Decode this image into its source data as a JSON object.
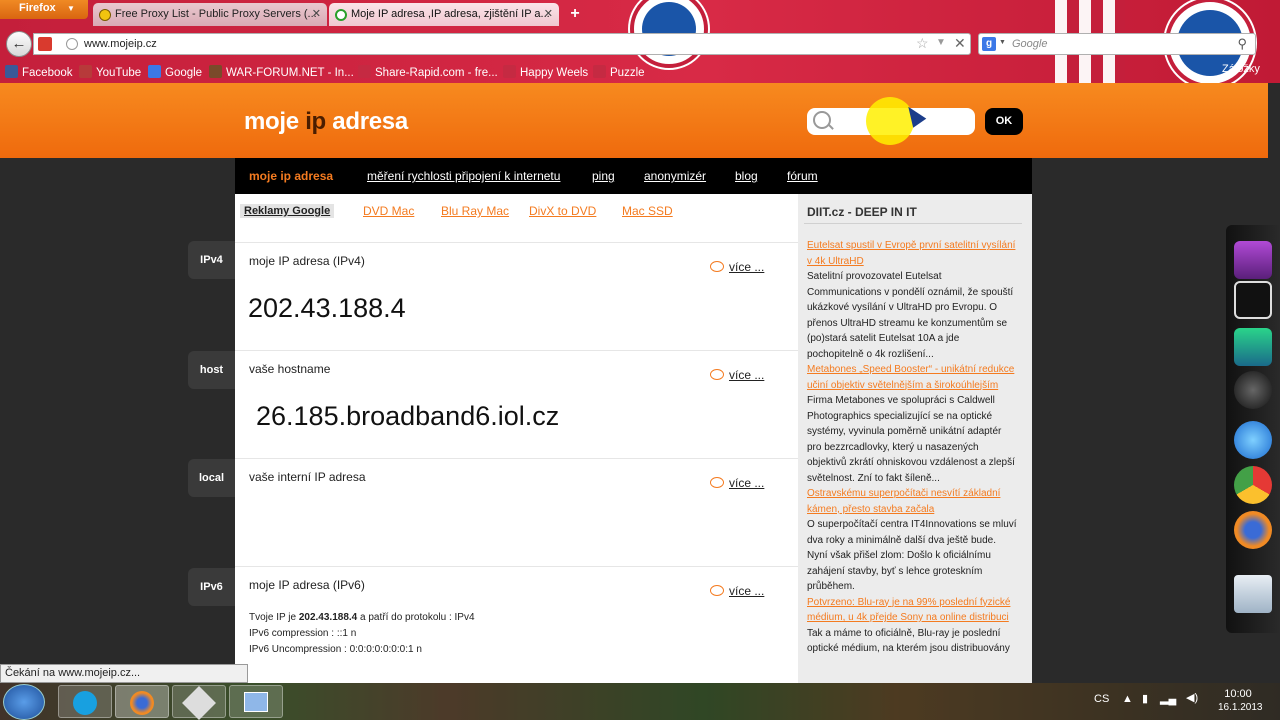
{
  "browser": {
    "app_button": "Firefox",
    "tabs": [
      {
        "label": "Free Proxy List - Public Proxy Servers (..."
      },
      {
        "label": "Moje IP adresa ,IP adresa, zjištění IP a..."
      }
    ],
    "url": "www.mojeip.cz",
    "search_placeholder": "Google",
    "bookmarks": [
      {
        "label": "Facebook",
        "icon": "facebook-icon"
      },
      {
        "label": "YouTube",
        "icon": "youtube-icon"
      },
      {
        "label": "Google",
        "icon": "google-icon"
      },
      {
        "label": "WAR-FORUM.NET - In...",
        "icon": "warforum-icon"
      },
      {
        "label": "Share-Rapid.com - fre...",
        "icon": "sharerapid-icon"
      },
      {
        "label": "Happy Weels",
        "icon": "page-icon"
      },
      {
        "label": "Puzzle",
        "icon": "page-icon"
      }
    ],
    "bookmarks_more": "Záložky",
    "status": "Čekání na www.mojeip.cz..."
  },
  "site": {
    "brand_main": "moje ",
    "brand_ip": "ip",
    "brand_rest": " adresa",
    "search_button": "OK",
    "menu": [
      "moje ip adresa",
      "měření rychlosti připojení k internetu",
      "ping",
      "anonymizér",
      "blog",
      "fórum"
    ],
    "ads_label": "Reklamy Google",
    "ads": [
      "DVD Mac",
      "Blu Ray Mac",
      "DivX to DVD",
      "Mac SSD"
    ],
    "more_label": "více ...",
    "sections": [
      {
        "tab": "IPv4",
        "title": "moje IP adresa (IPv4)",
        "value": "202.43.188.4"
      },
      {
        "tab": "host",
        "title": "vaše hostname",
        "value": "26.185.broadband6.iol.cz"
      },
      {
        "tab": "local",
        "title": "vaše interní IP adresa",
        "value": ""
      },
      {
        "tab": "IPv6",
        "title": "moje IP adresa (IPv6)",
        "value": ""
      }
    ],
    "ipv6": {
      "line1_a": "Tvoje IP je ",
      "line1_ip": "202.43.188.4",
      "line1_b": " a patří do protokolu : IPv4",
      "line2": "IPv6 compression : ::1 n",
      "line3": "IPv6 Uncompression : 0:0:0:0:0:0:0:1 n"
    },
    "sidebar": {
      "title": "DIIT.cz - DEEP IN IT",
      "articles": [
        {
          "title": "Eutelsat spustil v Evropě první satelitní vysílání v 4k UltraHD",
          "text": "Satelitní provozovatel Eutelsat Communications v pondělí oznámil, že spouští ukázkové vysílání v UltraHD pro Evropu. O přenos UltraHD streamu ke konzumentům se (po)stará satelit Eutelsat 10A a jde pochopitelně o 4k rozlišení..."
        },
        {
          "title": "Metabones „Speed Booster“ - unikátní redukce učiní objektiv světelnějším a širokoúhlejším",
          "text": "Firma Metabones ve spolupráci s Caldwell Photographics specializující se na optické systémy, vyvinula poměrně unikátní adaptér pro bezzrcadlovky, který u nasazených objektivů zkrátí ohniskovou vzdálenost a zlepší světelnost. Zní to fakt šíleně..."
        },
        {
          "title": "Ostravskému superpočítači nesvítí základní kámen, přesto stavba začala",
          "text": "O superpočítačí centra IT4Innovations se mluví dva roky a minimálně další dva ještě bude. Nyní však přišel zlom: Došlo k oficiálnímu zahájení stavby, byť s lehce groteskním průběhem."
        },
        {
          "title": "Potvrzeno: Blu-ray je na 99% poslední fyzické médium, u 4k přejde Sony na online distribuci",
          "text": "Tak a máme to oficiálně, Blu-ray je poslední optické médium, na kterém jsou distribuovány"
        }
      ]
    }
  },
  "taskbar": {
    "language": "CS",
    "time": "10:00",
    "date": "16.1.2013"
  }
}
